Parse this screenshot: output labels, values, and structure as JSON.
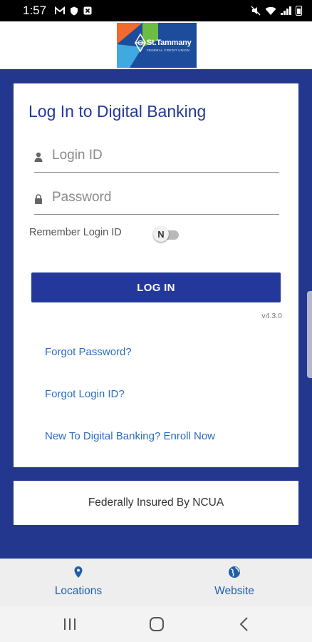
{
  "status_bar": {
    "time": "1:57",
    "left_icons": [
      "gmail-icon",
      "shield-icon",
      "square-x-icon"
    ],
    "right_icons": [
      "mute-icon",
      "wifi-icon",
      "signal-icon",
      "battery-icon"
    ]
  },
  "header": {
    "logo_text": "St.Tammany",
    "logo_subtext": "FEDERAL CREDIT UNION"
  },
  "login": {
    "title": "Log In to Digital Banking",
    "login_id_placeholder": "Login ID",
    "password_placeholder": "Password",
    "remember_label": "Remember Login ID",
    "remember_toggle_text": "N",
    "remember_enabled": false,
    "button_label": "LOG IN",
    "version": "v4.3.0"
  },
  "links": {
    "forgot_password": "Forgot Password?",
    "forgot_login_id": "Forgot Login ID?",
    "enroll": "New To Digital Banking? Enroll Now"
  },
  "ncua": {
    "text": "Federally Insured By NCUA"
  },
  "bottom_tabs": [
    {
      "label": "Locations",
      "icon": "location-pin-icon"
    },
    {
      "label": "Website",
      "icon": "globe-icon"
    }
  ],
  "nav_bar": {
    "buttons": [
      "recent-apps-icon",
      "home-icon",
      "back-icon"
    ]
  },
  "colors": {
    "brand_blue": "#23389a",
    "link_blue": "#2a6cc0",
    "logo_orange": "#f26a2e",
    "logo_green": "#6dbd45",
    "logo_light_blue": "#3fa9e0"
  }
}
